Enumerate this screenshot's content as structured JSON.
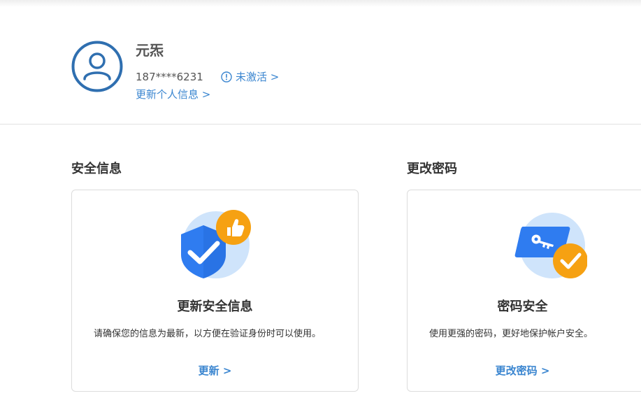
{
  "profile": {
    "name": "元炁",
    "phone": "187****6231",
    "activation_status": "未激活 >",
    "update_link": "更新个人信息 >"
  },
  "security_info": {
    "section_title": "安全信息",
    "card_heading": "更新安全信息",
    "card_description": "请确保您的信息为最新，以方便在验证身份时可以使用。",
    "card_link": "更新 >"
  },
  "change_password": {
    "section_title": "更改密码",
    "card_heading": "密码安全",
    "card_description": "使用更强的密码，更好地保护帐户安全。",
    "card_link": "更改密码 >"
  },
  "colors": {
    "accent": "#3b86d0",
    "avatar_ring": "#2f6fb0",
    "shield_blue": "#2f7cf0",
    "badge_orange": "#f7a416",
    "illustration_bg": "#cfe4fb",
    "divider": "#e2e2e2"
  },
  "icons": {
    "avatar": "user-avatar-icon",
    "activation": "info-circle-icon",
    "security": "shield-check-icon",
    "password": "key-card-icon"
  }
}
